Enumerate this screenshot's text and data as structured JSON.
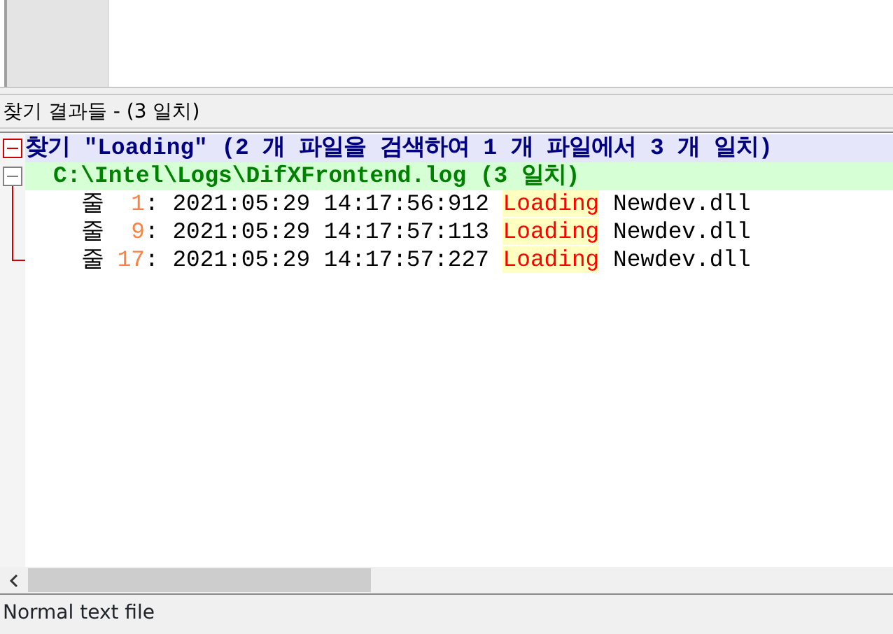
{
  "panel_title": "찾기 결과들 - (3 일치)",
  "search": {
    "header": "찾기 \"Loading\" (2 개 파일을 검색하여 1 개 파일에서 3 개 일치)",
    "expanded": true,
    "files": [
      {
        "path": "C:\\Intel\\Logs\\DifXFrontend.log (3 일치)",
        "expanded": true,
        "lines": [
          {
            "prefix": "줄",
            "number": "1",
            "text": ": 2021:05:29 14:17:56:912",
            "match": "Loading",
            "rest": "Newdev.dll"
          },
          {
            "prefix": "줄",
            "number": "9",
            "text": ": 2021:05:29 14:17:57:113",
            "match": "Loading",
            "rest": "Newdev.dll"
          },
          {
            "prefix": "줄",
            "number": "17",
            "text": ": 2021:05:29 14:17:57:227",
            "match": "Loading",
            "rest": "Newdev.dll"
          }
        ]
      }
    ]
  },
  "status_bar": "Normal text file"
}
